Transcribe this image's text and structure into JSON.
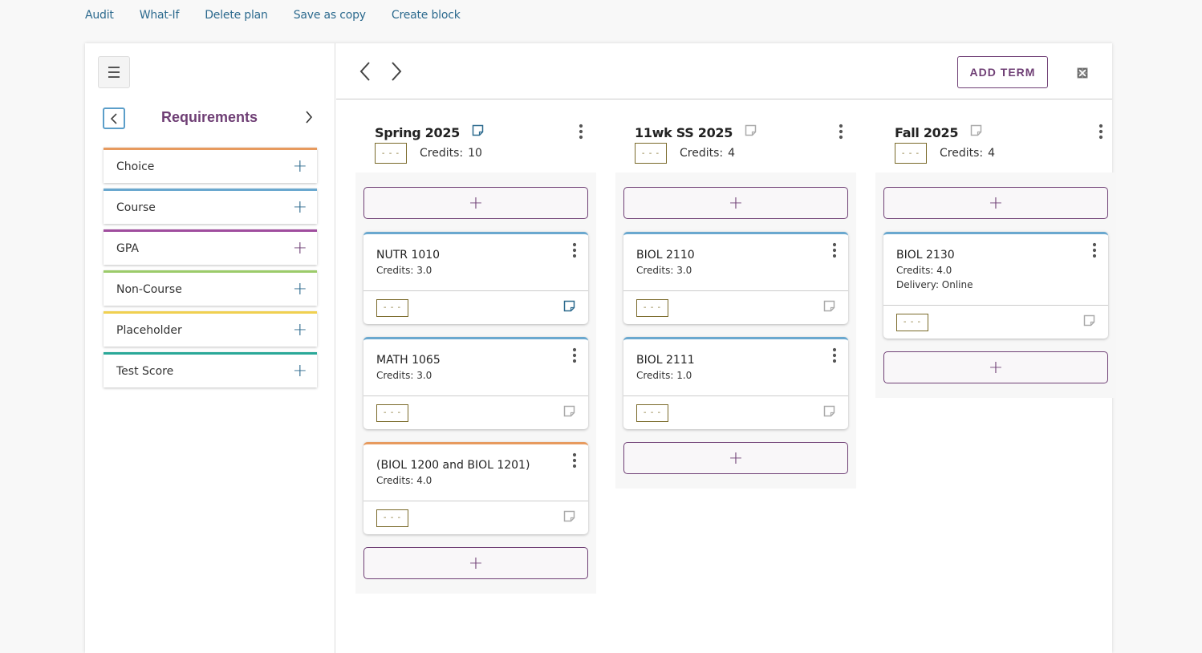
{
  "top_links": [
    "Audit",
    "What-If",
    "Delete plan",
    "Save as copy",
    "Create block"
  ],
  "sidebar": {
    "title": "Requirements",
    "items": [
      {
        "label": "Choice",
        "color": "#e79a5e"
      },
      {
        "label": "Course",
        "color": "#6aa8cf"
      },
      {
        "label": "GPA",
        "color": "#a04d9e"
      },
      {
        "label": "Non-Course",
        "color": "#9ccb6a"
      },
      {
        "label": "Placeholder",
        "color": "#f0d050"
      },
      {
        "label": "Test Score",
        "color": "#2aa898"
      }
    ]
  },
  "toolbar": {
    "add_term_label": "ADD TERM"
  },
  "grade_placeholder": "- - -",
  "credits_label": "Credits:",
  "terms": [
    {
      "name": "Spring 2025",
      "credits": "10",
      "note_active": true,
      "courses": [
        {
          "name": "NUTR 1010",
          "lines": [
            "Credits: 3.0"
          ],
          "type": "course",
          "note_active": true
        },
        {
          "name": "MATH 1065",
          "lines": [
            "Credits: 3.0"
          ],
          "type": "course",
          "note_active": false
        },
        {
          "name": "(BIOL 1200 and BIOL 1201)",
          "lines": [
            "Credits: 4.0"
          ],
          "type": "choice",
          "note_active": false
        }
      ]
    },
    {
      "name": "11wk SS 2025",
      "credits": "4",
      "note_active": false,
      "courses": [
        {
          "name": "BIOL 2110",
          "lines": [
            "Credits: 3.0"
          ],
          "type": "course",
          "note_active": false
        },
        {
          "name": "BIOL 2111",
          "lines": [
            "Credits: 1.0"
          ],
          "type": "course",
          "note_active": false
        }
      ]
    },
    {
      "name": "Fall 2025",
      "credits": "4",
      "note_active": false,
      "courses": [
        {
          "name": "BIOL 2130",
          "lines": [
            "Credits: 4.0",
            "Delivery: Online"
          ],
          "type": "course",
          "note_active": false
        }
      ]
    }
  ],
  "colors": {
    "accent_purple": "#6f3f75",
    "link_blue": "#2c6a8e",
    "course_border": "#6aa8cf",
    "choice_border": "#e79a5e"
  }
}
